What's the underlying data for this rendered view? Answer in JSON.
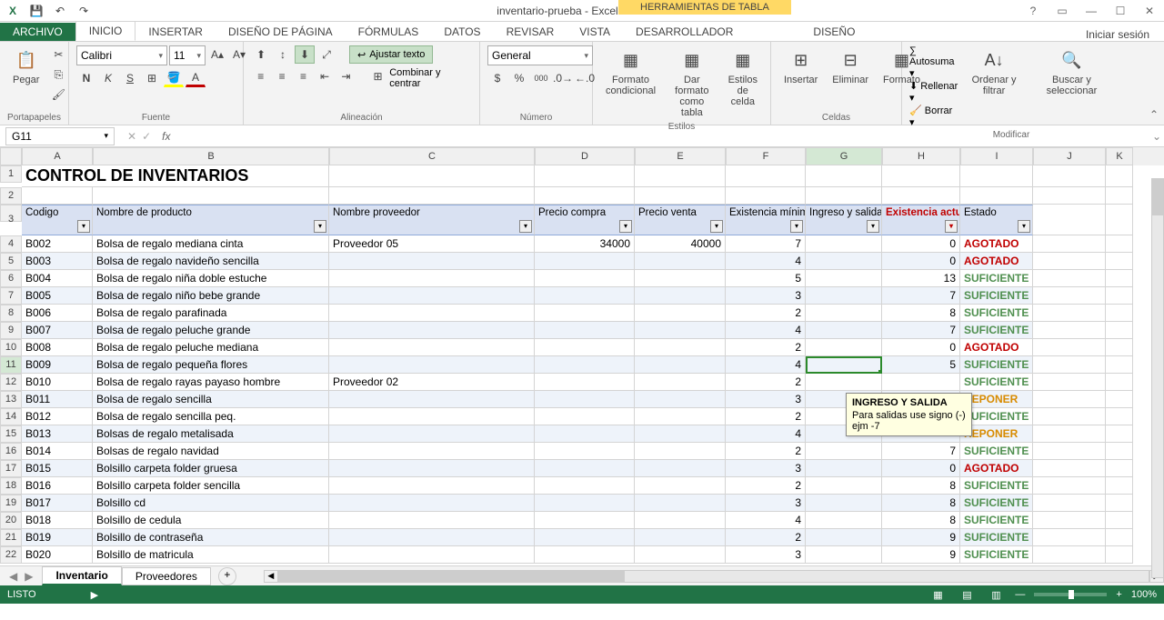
{
  "app": {
    "title": "inventario-prueba - Excel",
    "table_tools": "HERRAMIENTAS DE TABLA",
    "signin": "Iniciar sesión"
  },
  "tabs": {
    "file": "ARCHIVO",
    "home": "INICIO",
    "insert": "INSERTAR",
    "layout": "DISEÑO DE PÁGINA",
    "formulas": "FÓRMULAS",
    "data": "DATOS",
    "review": "REVISAR",
    "view": "VISTA",
    "developer": "DESARROLLADOR",
    "design": "DISEÑO"
  },
  "ribbon": {
    "clipboard": {
      "paste": "Pegar",
      "label": "Portapapeles"
    },
    "font": {
      "name": "Calibri",
      "size": "11",
      "label": "Fuente"
    },
    "align": {
      "wrap": "Ajustar texto",
      "merge": "Combinar y centrar",
      "label": "Alineación"
    },
    "number": {
      "format": "General",
      "label": "Número"
    },
    "styles": {
      "cond": "Formato condicional",
      "table": "Dar formato como tabla",
      "cell": "Estilos de celda",
      "label": "Estilos"
    },
    "cells": {
      "insert": "Insertar",
      "delete": "Eliminar",
      "format": "Formato",
      "label": "Celdas"
    },
    "editing": {
      "autosum": "Autosuma",
      "fill": "Rellenar",
      "clear": "Borrar",
      "sort": "Ordenar y filtrar",
      "find": "Buscar y seleccionar",
      "label": "Modificar"
    }
  },
  "namebox": "G11",
  "columns": [
    "A",
    "B",
    "C",
    "D",
    "E",
    "F",
    "G",
    "H",
    "I",
    "J",
    "K"
  ],
  "title": "CONTROL DE INVENTARIOS",
  "headers": {
    "code": "Codigo",
    "name": "Nombre de producto",
    "supplier": "Nombre proveedor",
    "buy": "Precio compra",
    "sell": "Precio venta",
    "min": "Existencia mínima",
    "io": "Ingreso y salidas",
    "current": "Existencia actual",
    "status": "Estado"
  },
  "rows": [
    {
      "n": 4,
      "code": "B002",
      "name": "Bolsa de regalo mediana cinta",
      "supplier": "Proveedor 05",
      "buy": "34000",
      "sell": "40000",
      "min": "7",
      "io": "",
      "cur": "0",
      "status": "AGOTADO",
      "cls": "red"
    },
    {
      "n": 5,
      "code": "B003",
      "name": "Bolsa de regalo navideño sencilla",
      "supplier": "",
      "buy": "",
      "sell": "",
      "min": "4",
      "io": "",
      "cur": "0",
      "status": "AGOTADO",
      "cls": "red"
    },
    {
      "n": 6,
      "code": "B004",
      "name": "Bolsa de regalo niña doble estuche",
      "supplier": "",
      "buy": "",
      "sell": "",
      "min": "5",
      "io": "",
      "cur": "13",
      "status": "SUFICIENTE",
      "cls": "green"
    },
    {
      "n": 7,
      "code": "B005",
      "name": "Bolsa de regalo niño bebe grande",
      "supplier": "",
      "buy": "",
      "sell": "",
      "min": "3",
      "io": "",
      "cur": "7",
      "status": "SUFICIENTE",
      "cls": "green"
    },
    {
      "n": 8,
      "code": "B006",
      "name": "Bolsa de regalo parafinada",
      "supplier": "",
      "buy": "",
      "sell": "",
      "min": "2",
      "io": "",
      "cur": "8",
      "status": "SUFICIENTE",
      "cls": "green"
    },
    {
      "n": 9,
      "code": "B007",
      "name": "Bolsa de regalo peluche grande",
      "supplier": "",
      "buy": "",
      "sell": "",
      "min": "4",
      "io": "",
      "cur": "7",
      "status": "SUFICIENTE",
      "cls": "green"
    },
    {
      "n": 10,
      "code": "B008",
      "name": "Bolsa de regalo peluche mediana",
      "supplier": "",
      "buy": "",
      "sell": "",
      "min": "2",
      "io": "",
      "cur": "0",
      "status": "AGOTADO",
      "cls": "red"
    },
    {
      "n": 11,
      "code": "B009",
      "name": "Bolsa de regalo pequeña flores",
      "supplier": "",
      "buy": "",
      "sell": "",
      "min": "4",
      "io": "",
      "cur": "5",
      "status": "SUFICIENTE",
      "cls": "green"
    },
    {
      "n": 12,
      "code": "B010",
      "name": "Bolsa de regalo rayas payaso hombre",
      "supplier": "Proveedor 02",
      "buy": "",
      "sell": "",
      "min": "2",
      "io": "",
      "cur": "",
      "status": "SUFICIENTE",
      "cls": "green"
    },
    {
      "n": 13,
      "code": "B011",
      "name": "Bolsa de regalo sencilla",
      "supplier": "",
      "buy": "",
      "sell": "",
      "min": "3",
      "io": "",
      "cur": "",
      "status": "REPONER",
      "cls": "orange"
    },
    {
      "n": 14,
      "code": "B012",
      "name": "Bolsa de regalo sencilla peq.",
      "supplier": "",
      "buy": "",
      "sell": "",
      "min": "2",
      "io": "",
      "cur": "",
      "status": "SUFICIENTE",
      "cls": "green"
    },
    {
      "n": 15,
      "code": "B013",
      "name": "Bolsas de regalo metalisada",
      "supplier": "",
      "buy": "",
      "sell": "",
      "min": "4",
      "io": "",
      "cur": "",
      "status": "REPONER",
      "cls": "orange"
    },
    {
      "n": 16,
      "code": "B014",
      "name": "Bolsas de regalo navidad",
      "supplier": "",
      "buy": "",
      "sell": "",
      "min": "2",
      "io": "",
      "cur": "7",
      "status": "SUFICIENTE",
      "cls": "green"
    },
    {
      "n": 17,
      "code": "B015",
      "name": "Bolsillo carpeta folder gruesa",
      "supplier": "",
      "buy": "",
      "sell": "",
      "min": "3",
      "io": "",
      "cur": "0",
      "status": "AGOTADO",
      "cls": "red"
    },
    {
      "n": 18,
      "code": "B016",
      "name": "Bolsillo carpeta folder sencilla",
      "supplier": "",
      "buy": "",
      "sell": "",
      "min": "2",
      "io": "",
      "cur": "8",
      "status": "SUFICIENTE",
      "cls": "green"
    },
    {
      "n": 19,
      "code": "B017",
      "name": "Bolsillo cd",
      "supplier": "",
      "buy": "",
      "sell": "",
      "min": "3",
      "io": "",
      "cur": "8",
      "status": "SUFICIENTE",
      "cls": "green"
    },
    {
      "n": 20,
      "code": "B018",
      "name": "Bolsillo de cedula",
      "supplier": "",
      "buy": "",
      "sell": "",
      "min": "4",
      "io": "",
      "cur": "8",
      "status": "SUFICIENTE",
      "cls": "green"
    },
    {
      "n": 21,
      "code": "B019",
      "name": "Bolsillo de contraseña",
      "supplier": "",
      "buy": "",
      "sell": "",
      "min": "2",
      "io": "",
      "cur": "9",
      "status": "SUFICIENTE",
      "cls": "green"
    },
    {
      "n": 22,
      "code": "B020",
      "name": "Bolsillo de matricula",
      "supplier": "",
      "buy": "",
      "sell": "",
      "min": "3",
      "io": "",
      "cur": "9",
      "status": "SUFICIENTE",
      "cls": "green"
    }
  ],
  "tooltip": {
    "title": "INGRESO Y SALIDA",
    "line1": "Para salidas use signo (-)",
    "line2": "ejm -7"
  },
  "sheets": {
    "s1": "Inventario",
    "s2": "Proveedores"
  },
  "status": {
    "ready": "LISTO",
    "zoom": "100%"
  }
}
